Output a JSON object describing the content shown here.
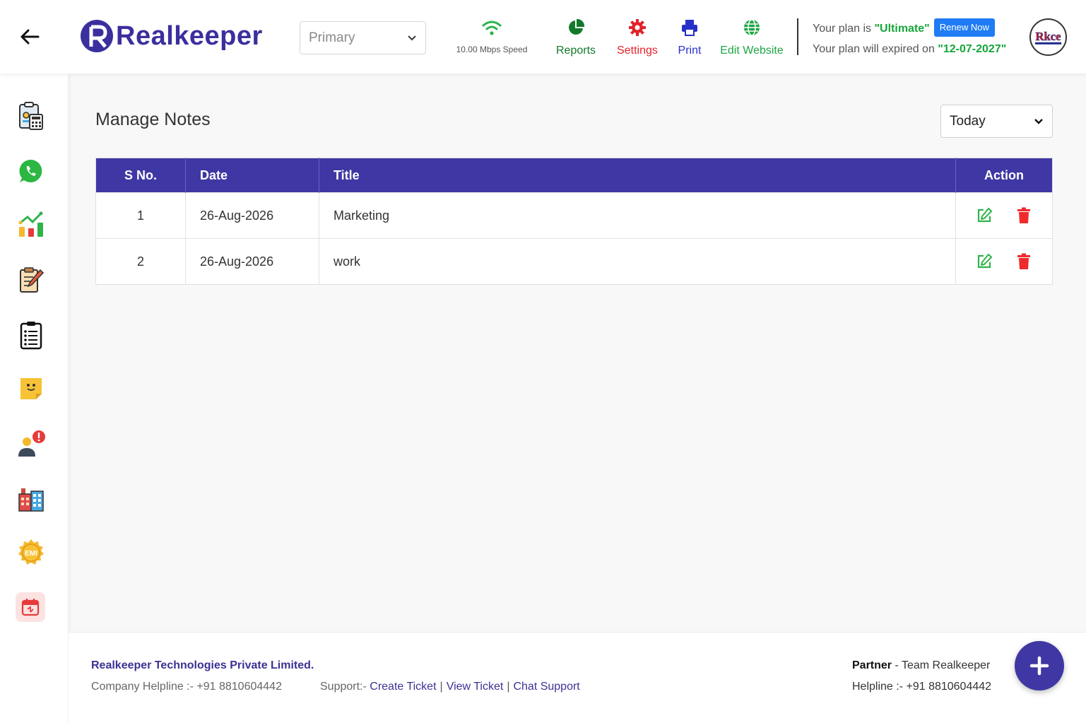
{
  "header": {
    "brand": "Realkeeper",
    "branch_select": "Primary",
    "speed": "10.00 Mbps Speed",
    "links": {
      "reports": "Reports",
      "settings": "Settings",
      "print": "Print",
      "edit_website": "Edit Website"
    },
    "plan": {
      "prefix": "Your plan is ",
      "name": "\"Ultimate\"",
      "renew": "Renew Now",
      "expiry_prefix": "Your plan will expired on ",
      "expiry_date": "\"12-07-2027\""
    },
    "avatar_text": "Rkce"
  },
  "sidebar": {
    "items": [
      "billing-icon",
      "whatsapp-icon",
      "analytics-icon",
      "notes-edit-icon",
      "checklist-icon",
      "sticky-note-icon",
      "user-alert-icon",
      "company-icon",
      "emi-icon",
      "calendar-icon"
    ]
  },
  "main": {
    "title": "Manage Notes",
    "filter": "Today",
    "table": {
      "headers": {
        "sno": "S No.",
        "date": "Date",
        "title": "Title",
        "action": "Action"
      },
      "rows": [
        {
          "sno": "1",
          "date": "26-Aug-2026",
          "title": "Marketing"
        },
        {
          "sno": "2",
          "date": "26-Aug-2026",
          "title": "work"
        }
      ]
    }
  },
  "footer": {
    "company": "Realkeeper Technologies Private Limited.",
    "helpline": "Company Helpline :- +91 8810604442",
    "support_label": "Support:- ",
    "create_ticket": "Create Ticket",
    "view_ticket": "View Ticket",
    "chat_support": "Chat Support",
    "separator": "|",
    "partner_label": "Partner",
    "partner_value": " - Team Realkeeper",
    "partner_helpline": "Helpline :- +91 8810604442"
  },
  "colors": {
    "brand": "#3f37a3",
    "reports": "#137a2a",
    "settings": "#e3212a",
    "print": "#2630c9",
    "edit_website": "#1fa545",
    "renew": "#1f7cf5"
  }
}
